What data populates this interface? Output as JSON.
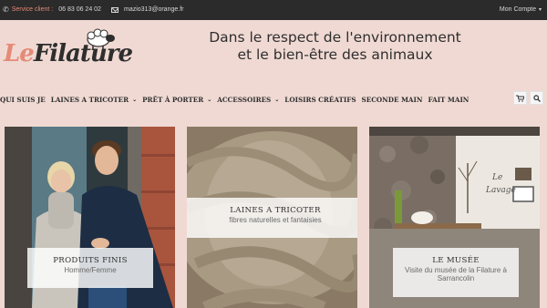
{
  "topbar": {
    "service_label": "Service client :",
    "phone": "06 83 06 24 02",
    "email": "mazio313@orange.fr",
    "account_label": "Mon Compte",
    "icons": {
      "phone": "phone-icon",
      "mail": "mail-icon",
      "account_caret": "chevron-down-icon"
    },
    "accent_color": "#e48a77"
  },
  "logo": {
    "le": "Le",
    "filature": "Filature"
  },
  "tagline": {
    "line1": "Dans le respect de l'environnement",
    "line2": "et le bien-être des animaux"
  },
  "nav": {
    "items": [
      {
        "label": "QUI SUIS JE",
        "dropdown": false
      },
      {
        "label": "LAINES A TRICOTER",
        "dropdown": true
      },
      {
        "label": "PRÊT À PORTER",
        "dropdown": true
      },
      {
        "label": "ACCESSOIRES",
        "dropdown": true
      },
      {
        "label": "LOISIRS CRÉATIFS",
        "dropdown": false
      },
      {
        "label": "SECONDE MAIN",
        "dropdown": false
      },
      {
        "label": "FAIT MAIN",
        "dropdown": false
      }
    ],
    "cart_icon": "cart-icon",
    "search_icon": "search-icon"
  },
  "cards": [
    {
      "title": "PRODUITS FINIS",
      "subtitle": "Homme/Femme"
    },
    {
      "title": "LAINES A TRICOTER",
      "subtitle": "fibres naturelles et fantaisies"
    },
    {
      "title": "LE MUSÉE",
      "subtitle": "Visite du musée de la Filature à Sarrancolin"
    }
  ],
  "colors": {
    "background": "#f0d9d3",
    "topbar": "#2b2b2b",
    "text": "#2e2e2e"
  }
}
